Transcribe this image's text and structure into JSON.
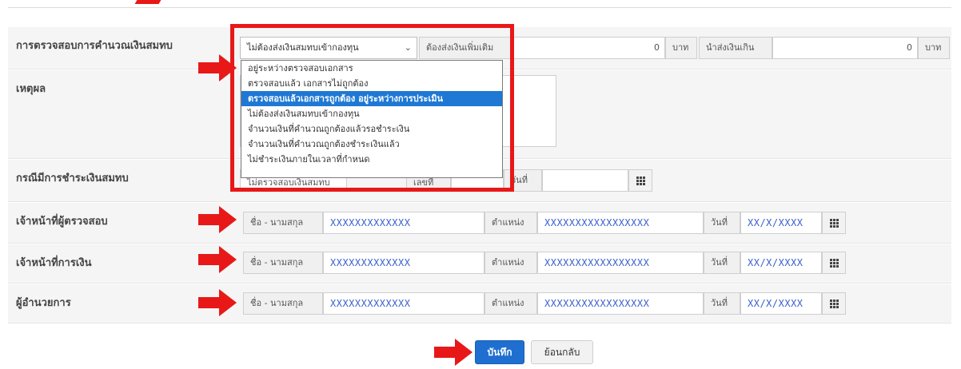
{
  "check_row": {
    "label": "การตรวจสอบการคำนวณเงินสมทบ",
    "status_select_value": "ไม่ต้องส่งเงินสมทบเข้ากองทุน",
    "additional_label": "ต้องส่งเงินเพิ่มเติม",
    "additional_value": "0",
    "currency": "บาท",
    "overpaid_label": "นำส่งเงินเกิน",
    "overpaid_value": "0"
  },
  "status_dropdown": {
    "options": [
      "อยู่ระหว่างตรวจสอบเอกสาร",
      "ตรวจสอบแล้ว เอกสารไม่ถูกต้อง",
      "ตรวจสอบแล้วเอกสารถูกต้อง อยู่ระหว่างการประเมิน",
      "ไม่ต้องส่งเงินสมทบเข้ากองทุน",
      "จำนวนเงินที่คำนวณถูกต้องแล้วรอชำระเงิน",
      "จำนวนเงินที่คำนวณถูกต้องชำระเงินแล้ว",
      "ไม่ชำระเงินภายในเวลาที่กำหนด"
    ],
    "highlighted_option": "ตรวจสอบแล้วเอกสารถูกต้อง อยู่ระหว่างการประเมิน"
  },
  "reason_row": {
    "label": "เหตุผล"
  },
  "payment_row": {
    "label": "กรณีมีการชำระเงินสมทบ",
    "amount_partial": "ไม่ตรวจสอบเงินสมทบ",
    "receipt_partial": "เลขที่",
    "date_label": "วันที่"
  },
  "person_rows": [
    {
      "label": "เจ้าหน้าที่ผู้ตรวจสอบ",
      "name_label": "ชื่อ - นามสกุล",
      "name_value": "XXXXXXXXXXXXX",
      "position_label": "ตำแหน่ง",
      "position_value": "XXXXXXXXXXXXXXXXX",
      "date_label": "วันที่",
      "date_value": "XX/X/XXXX"
    },
    {
      "label": "เจ้าหน้าที่การเงิน",
      "name_label": "ชื่อ - นามสกุล",
      "name_value": "XXXXXXXXXXXXX",
      "position_label": "ตำแหน่ง",
      "position_value": "XXXXXXXXXXXXXXXXX",
      "date_label": "วันที่",
      "date_value": "XX/X/XXXX"
    },
    {
      "label": "ผู้อำนวยการ",
      "name_label": "ชื่อ - นามสกุล",
      "name_value": "XXXXXXXXXXXXX",
      "position_label": "ตำแหน่ง",
      "position_value": "XXXXXXXXXXXXXXXXX",
      "date_label": "วันที่",
      "date_value": "XX/X/XXXX"
    }
  ],
  "buttons": {
    "save": "บันทึก",
    "back": "ย้อนกลับ"
  },
  "colors": {
    "annotation_red": "#e81818",
    "primary_blue": "#1e6fd0",
    "highlight_blue": "#1e78d4",
    "masked_text": "#3a5fcd"
  }
}
